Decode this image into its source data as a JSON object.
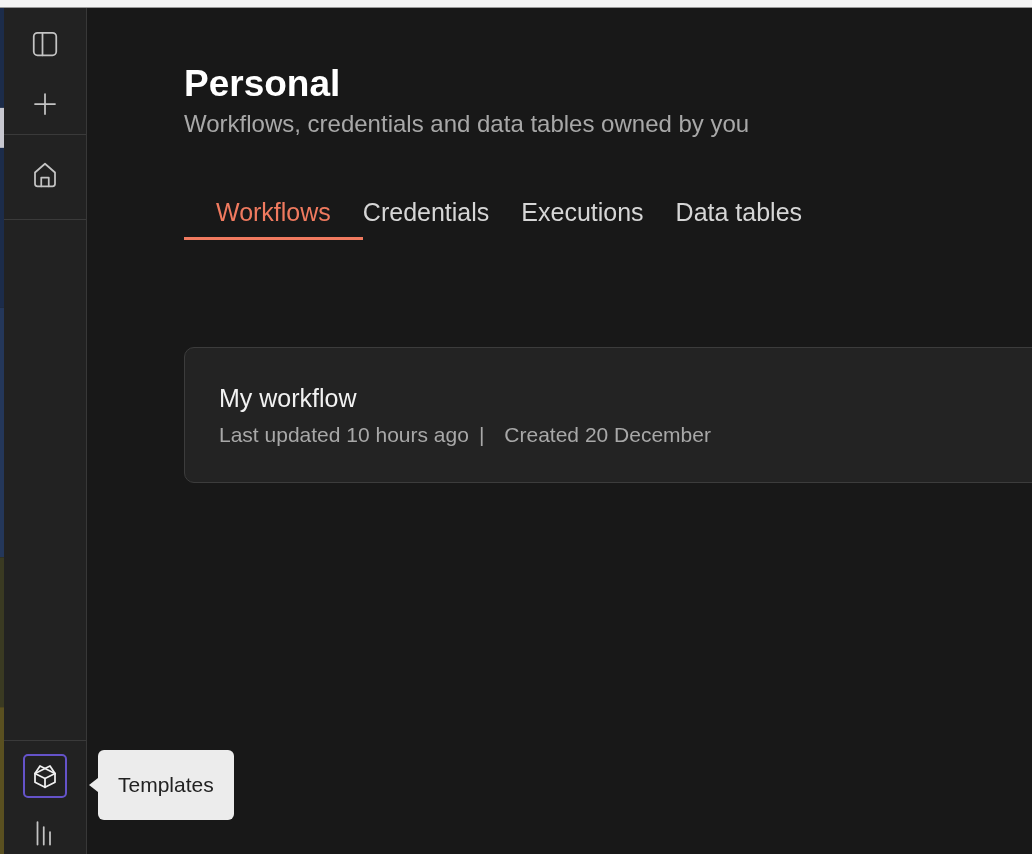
{
  "sidebar": {
    "top_items": [
      {
        "kind": "panel"
      },
      {
        "kind": "plus"
      }
    ],
    "nav_items": [
      {
        "kind": "home",
        "focused": false
      }
    ],
    "bottom_items": [
      {
        "kind": "templates",
        "focused": true
      },
      {
        "kind": "insights",
        "focused": false
      }
    ],
    "tooltip": "Templates"
  },
  "header": {
    "title": "Personal",
    "subtitle": "Workflows, credentials and data tables owned by you"
  },
  "tabs": [
    {
      "label": "Workflows",
      "selected": true
    },
    {
      "label": "Credentials",
      "selected": false
    },
    {
      "label": "Executions",
      "selected": false
    },
    {
      "label": "Data tables",
      "selected": false
    }
  ],
  "workflows": [
    {
      "name": "My workflow",
      "updated": "Last updated 10 hours ago",
      "separator": "|",
      "created": "Created 20 December"
    }
  ]
}
